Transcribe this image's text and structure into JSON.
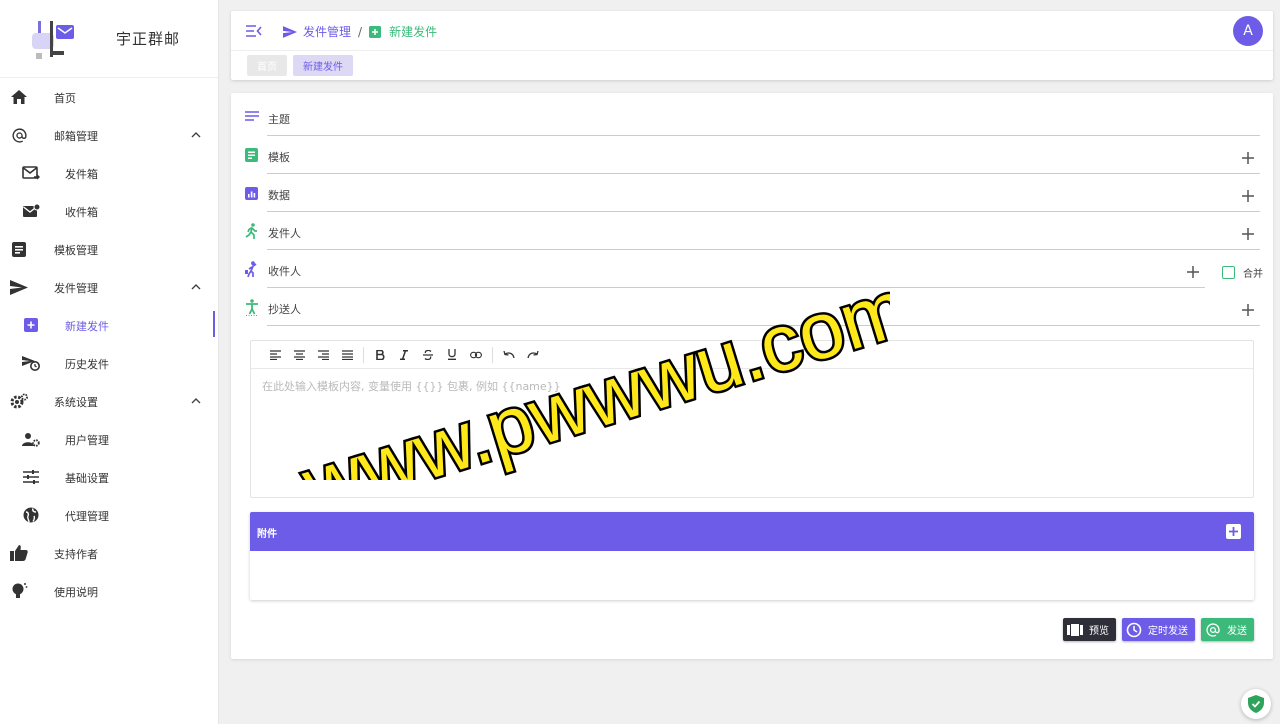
{
  "brand": {
    "title": "宇正群邮"
  },
  "sidebar": {
    "items": [
      {
        "label": "首页",
        "icon": "home-icon"
      },
      {
        "label": "邮箱管理",
        "icon": "at-icon",
        "expanded": true
      },
      {
        "label": "发件箱",
        "icon": "mail-send-icon",
        "sub": true
      },
      {
        "label": "收件箱",
        "icon": "mail-inbox-icon",
        "sub": true
      },
      {
        "label": "模板管理",
        "icon": "template-icon"
      },
      {
        "label": "发件管理",
        "icon": "send-icon",
        "expanded": true
      },
      {
        "label": "新建发件",
        "icon": "add-box-icon",
        "sub": true,
        "active": true
      },
      {
        "label": "历史发件",
        "icon": "history-send-icon",
        "sub": true
      },
      {
        "label": "系统设置",
        "icon": "settings-icon",
        "expanded": true
      },
      {
        "label": "用户管理",
        "icon": "user-settings-icon",
        "sub": true
      },
      {
        "label": "基础设置",
        "icon": "tune-icon",
        "sub": true
      },
      {
        "label": "代理管理",
        "icon": "globe-icon",
        "sub": true
      },
      {
        "label": "支持作者",
        "icon": "thumb-up-icon"
      },
      {
        "label": "使用说明",
        "icon": "lightbulb-icon"
      }
    ]
  },
  "header": {
    "breadcrumb": [
      {
        "label": "发件管理",
        "icon": "send-icon"
      },
      {
        "label": "新建发件",
        "icon": "add-box-icon"
      }
    ],
    "separator": "/",
    "avatar": "A",
    "tabs": [
      {
        "label": "首页",
        "active": false
      },
      {
        "label": "新建发件",
        "active": true
      }
    ]
  },
  "form": {
    "fields": [
      {
        "label": "主题",
        "icon": "subject-icon",
        "addable": false
      },
      {
        "label": "模板",
        "icon": "template-icon",
        "addable": true
      },
      {
        "label": "数据",
        "icon": "chart-box-icon",
        "addable": true
      },
      {
        "label": "发件人",
        "icon": "walk-icon",
        "addable": true
      },
      {
        "label": "收件人",
        "icon": "person-receive-icon",
        "addable": true,
        "merge": true
      },
      {
        "label": "抄送人",
        "icon": "accessibility-icon",
        "addable": true
      }
    ],
    "merge_label": "合并",
    "editor_placeholder": "在此处输入模板内容, 变量使用 {{}} 包裹, 例如 {{name}}",
    "attachment_title": "附件",
    "buttons": {
      "preview": "预览",
      "schedule": "定时发送",
      "send": "发送"
    }
  },
  "watermark": "www.pwwwu.com",
  "colors": {
    "primary": "#6c5ce7",
    "success": "#3cba7b",
    "dark": "#2f2f3a"
  }
}
